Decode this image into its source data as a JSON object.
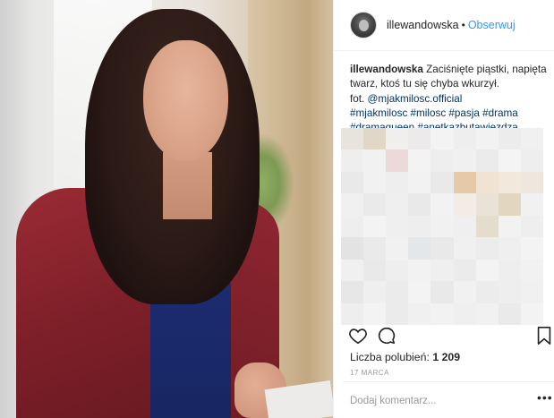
{
  "post": {
    "username": "illewandowska",
    "separator": "•",
    "follow_label": "Obserwuj",
    "caption": {
      "user": "illewandowska",
      "line1_text": " Zaciśnięte piąstki, napięta",
      "line2": "twarz, ktoś tu się chyba wkurzył.",
      "line3_prefix": "fot. ",
      "mention": "@mjakmilosc.official",
      "hashtags_line1": "#mjakmilosc #milosc #pasja #drama",
      "hashtags_line2": "#dramaqueen #anetkazbutawjezdza"
    },
    "likes_label": "Liczba polubień:",
    "likes_count": "1 209",
    "date": "17 MARCA",
    "comment_placeholder": "Dodaj komentarz...",
    "more_label": "•••"
  },
  "icons": {
    "heart": "heart-icon",
    "comment": "comment-icon",
    "bookmark": "bookmark-icon",
    "more": "more-options-icon"
  },
  "colors": {
    "link": "#003569",
    "follow": "#3897f0",
    "text": "#262626",
    "muted": "#999999"
  }
}
